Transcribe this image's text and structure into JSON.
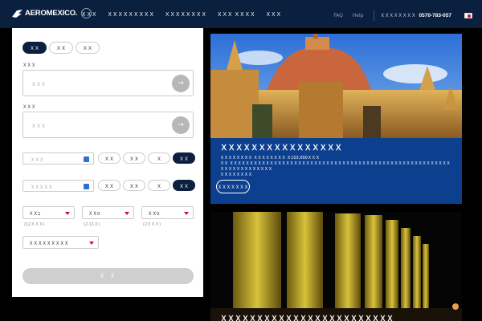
{
  "header": {
    "brand": "AEROMEXICO.",
    "nav": [
      "ＸＸＸ",
      "ＸＸＸＸＸＸＸＸＸ",
      "ＸＸＸＸＸＸＸＸ",
      "ＸＸＸ ＸＸＸＸ",
      "ＸＸＸ"
    ],
    "faq": "FAQ",
    "help": "Help",
    "phone_label": "ＸＸＸＸＸＸＸＸ",
    "phone": "0570-783-057"
  },
  "booking": {
    "trip_types": [
      "ＸＸ",
      "ＸＸ",
      "ＸＸ"
    ],
    "from_label": "ＸＸＸ",
    "from_placeholder": "ＸＸＸ",
    "to_label": "ＸＸＸ",
    "to_placeholder": "ＸＸＸ",
    "depart_placeholder": "ＸＸＸ",
    "return_placeholder": "ＸＸＸＸＸ",
    "depart_time_options": [
      "ＸＸ",
      "ＸＸ",
      "Ｘ",
      "ＸＸ"
    ],
    "return_time_options": [
      "ＸＸ",
      "ＸＸ",
      "Ｘ",
      "ＸＸ"
    ],
    "adults": "ＸＸ1",
    "children": "ＸＸ0",
    "infants": "ＸＸ0",
    "adults_hint": "(12ＸＸＸ)",
    "children_hint": "(2-11Ｘ)",
    "infants_hint": "(2ＸＸＸ)",
    "cabin": "ＸＸＸＸＸＸＸＸＸ",
    "search_label": "Ｘ Ｘ"
  },
  "promo": {
    "title": "ＸＸＸＸＸＸＸＸＸＸＸＸＸＸＸＸ",
    "desc_line1": "ＸＸＸＸＸＸＸＸ ＸＸＸＸＸＸＸＸ Ｘ103,000ＸＸＸ",
    "desc_line2": "ＸＸ ＸＸＸＸＸＸＸＸＸＸＸＸＸＸＸＸＸＸＸＸＸＸＸＸＸＸＸＸＸＸＸＸＸＸＸＸＸＸＸＸＸＸＸＸＸＸＸＸＸＸＸＸＸＸＸＸＸＸＸＸＸＸＸＸＸＸＸＸ",
    "desc_line3": "ＸＸＸＸＸＸＸＸ",
    "cta": "ＸＸＸＸＸＸＸ",
    "title2": "ＸＸＸＸＸＸＸＸＸＸＸＸＸＸＸＸＸＸＸＸＸＸＸＸ"
  },
  "colors": {
    "navy": "#0b1f3f",
    "accent_red": "#c8102e",
    "promo_blue": "#0d3f8f"
  }
}
